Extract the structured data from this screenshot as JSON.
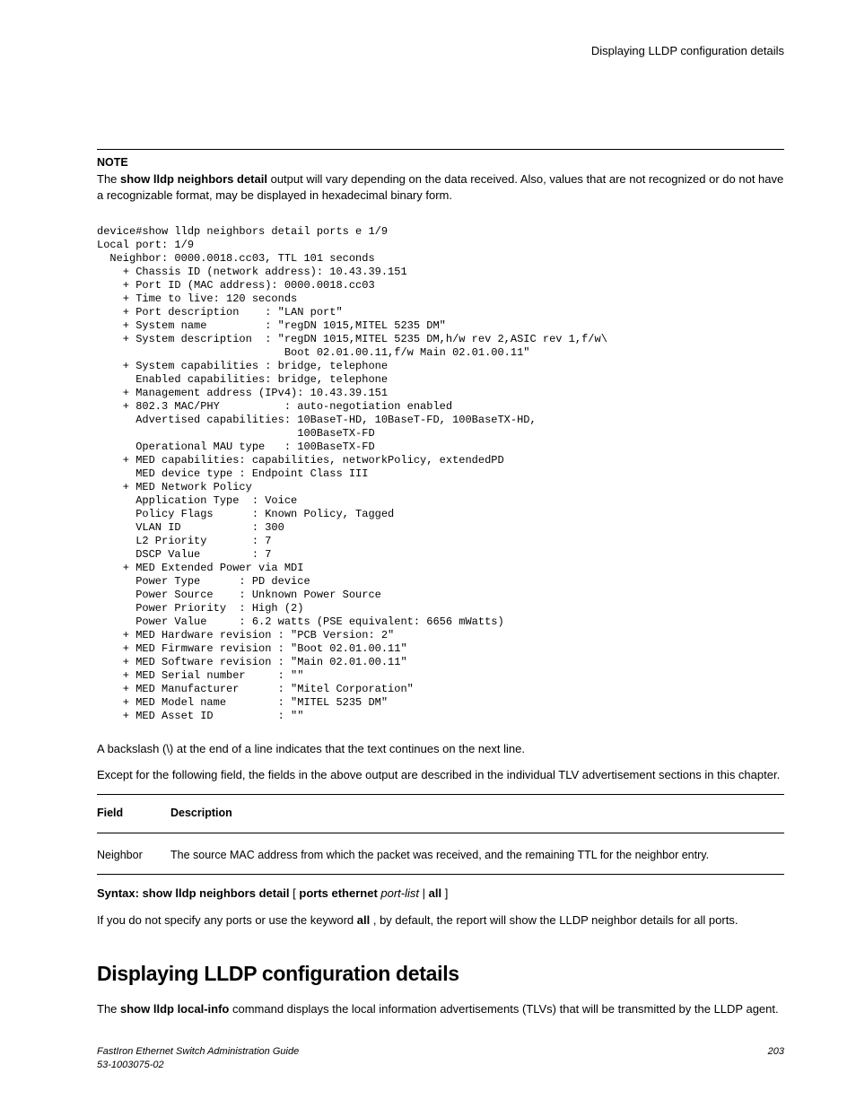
{
  "running_head": "Displaying LLDP configuration details",
  "note": {
    "label": "NOTE",
    "before_bold": "The ",
    "bold": "show lldp neighbors detail",
    "after_bold": " output will vary depending on the data received. Also, values that are not recognized or do not have a recognizable format, may be displayed in hexadecimal binary form."
  },
  "code": "device#show lldp neighbors detail ports e 1/9\nLocal port: 1/9\n  Neighbor: 0000.0018.cc03, TTL 101 seconds\n    + Chassis ID (network address): 10.43.39.151\n    + Port ID (MAC address): 0000.0018.cc03\n    + Time to live: 120 seconds\n    + Port description    : \"LAN port\"\n    + System name         : \"regDN 1015,MITEL 5235 DM\"\n    + System description  : \"regDN 1015,MITEL 5235 DM,h/w rev 2,ASIC rev 1,f/w\\\n                             Boot 02.01.00.11,f/w Main 02.01.00.11\"\n    + System capabilities : bridge, telephone\n      Enabled capabilities: bridge, telephone\n    + Management address (IPv4): 10.43.39.151\n    + 802.3 MAC/PHY          : auto-negotiation enabled\n      Advertised capabilities: 10BaseT-HD, 10BaseT-FD, 100BaseTX-HD,\n                               100BaseTX-FD\n      Operational MAU type   : 100BaseTX-FD\n    + MED capabilities: capabilities, networkPolicy, extendedPD\n      MED device type : Endpoint Class III\n    + MED Network Policy\n      Application Type  : Voice\n      Policy Flags      : Known Policy, Tagged\n      VLAN ID           : 300\n      L2 Priority       : 7\n      DSCP Value        : 7\n    + MED Extended Power via MDI\n      Power Type      : PD device\n      Power Source    : Unknown Power Source\n      Power Priority  : High (2)\n      Power Value     : 6.2 watts (PSE equivalent: 6656 mWatts)\n    + MED Hardware revision : \"PCB Version: 2\"\n    + MED Firmware revision : \"Boot 02.01.00.11\"\n    + MED Software revision : \"Main 02.01.00.11\"\n    + MED Serial number     : \"\"\n    + MED Manufacturer      : \"Mitel Corporation\"\n    + MED Model name        : \"MITEL 5235 DM\"\n    + MED Asset ID          : \"\"",
  "para_backslash": "A backslash (\\) at the end of a line indicates that the text continues on the next line.",
  "para_except": "Except for the following field, the fields in the above output are described in the individual TLV advertisement sections in this chapter.",
  "table": {
    "head_field": "Field",
    "head_desc": "Description",
    "row_field": "Neighbor",
    "row_desc": "The source MAC address from which the packet was received, and the remaining TTL for the neighbor entry."
  },
  "syntax": {
    "prefix_bold": "Syntax: show lldp neighbors detail",
    "bracket_open": " [ ",
    "ports_bold": "ports ethernet",
    "portlist_ital": " port-list",
    "pipe": " | ",
    "all_bold": "all",
    "bracket_close": " ]"
  },
  "para_default_before": "If you do not specify any ports or use the keyword ",
  "para_default_bold": "all",
  "para_default_after": " , by default, the report will show the LLDP neighbor details for all ports.",
  "section_title": "Displaying LLDP configuration details",
  "section_body_before": "The ",
  "section_body_bold": "show lldp local-info",
  "section_body_after": " command displays the local information advertisements (TLVs) that will be transmitted by the LLDP agent.",
  "footer": {
    "left_line1": "FastIron Ethernet Switch Administration Guide",
    "left_line2": "53-1003075-02",
    "right": "203"
  }
}
